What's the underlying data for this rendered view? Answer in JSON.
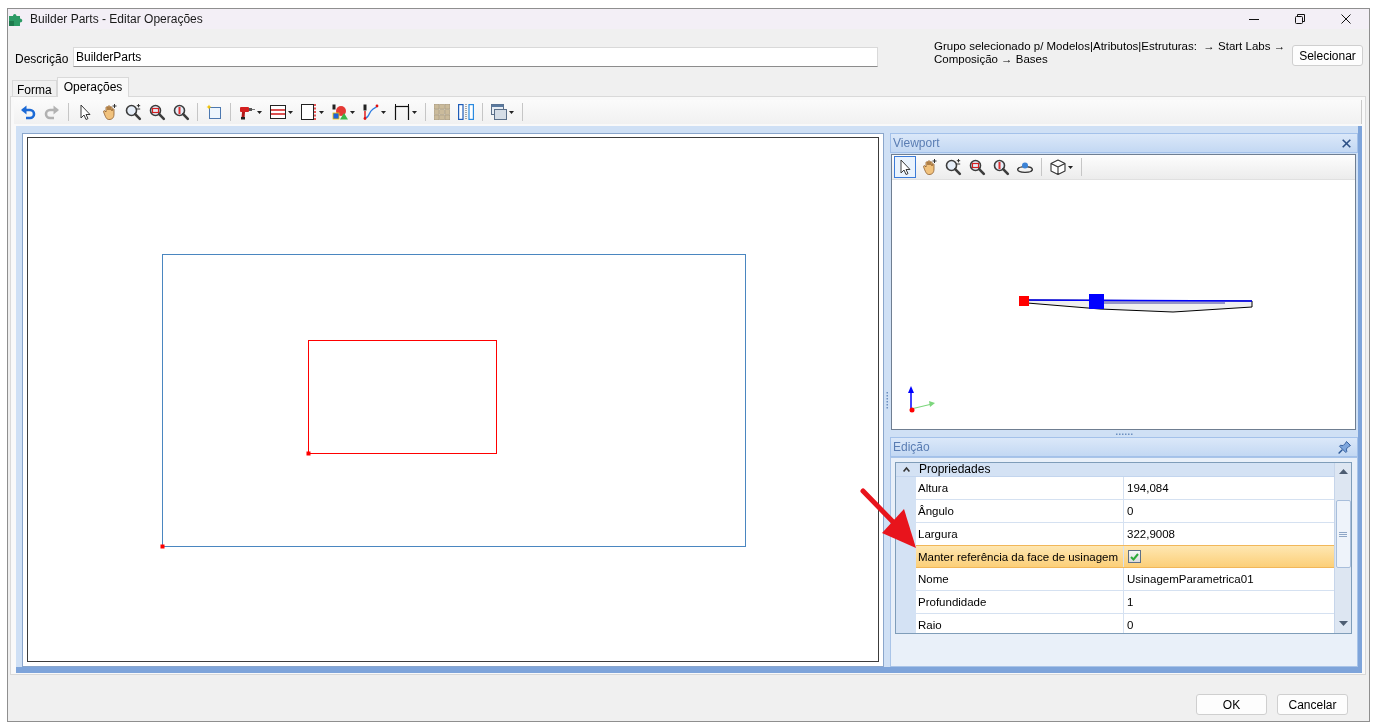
{
  "window": {
    "title": "Builder Parts - Editar Operações"
  },
  "description": {
    "label": "Descrição",
    "value": "BuilderParts"
  },
  "group_path": "Grupo selecionado p/ Modelos|Atributos|Estruturas:  → Start Labs → Composição → Bases",
  "select_button": "Selecionar",
  "tabs": [
    {
      "label": "Forma",
      "selected": false
    },
    {
      "label": "Operações",
      "selected": true
    }
  ],
  "toolbar": [
    {
      "disabled": false
    },
    {
      "disabled": true
    },
    {
      "disabled": false
    },
    {
      "disabled": false
    },
    {
      "disabled": false
    },
    {
      "disabled": false
    },
    {
      "disabled": false
    },
    {
      "disabled": false
    },
    {
      "disabled": false
    },
    {
      "disabled": false
    },
    {
      "disabled": false
    },
    {
      "disabled": false
    },
    {
      "disabled": false
    },
    {
      "disabled": false
    },
    {
      "disabled": false
    },
    {
      "disabled": false
    },
    {
      "disabled": false
    }
  ],
  "viewport": {
    "title": "Viewport",
    "toolbar": [
      {
        "selected": true
      },
      {
        "selected": false
      },
      {
        "selected": false
      },
      {
        "selected": false
      },
      {
        "selected": false
      },
      {
        "selected": false
      },
      {
        "selected": false
      }
    ]
  },
  "edit_panel": {
    "title": "Edição",
    "category": {
      "label": "Propriedades",
      "expanded": true
    },
    "properties": [
      {
        "kind": "text",
        "name": "Altura",
        "value": "194,084",
        "selected": false
      },
      {
        "kind": "text",
        "name": "Ângulo",
        "value": "0",
        "selected": false
      },
      {
        "kind": "text",
        "name": "Largura",
        "value": "322,9008",
        "selected": false
      },
      {
        "kind": "checkbox",
        "name": "Manter referência da face de usinagem",
        "checked": true,
        "selected": true
      },
      {
        "kind": "text",
        "name": "Nome",
        "value": "UsinagemParametrica01",
        "selected": false
      },
      {
        "kind": "text",
        "name": "Profundidade",
        "value": "1",
        "selected": false
      },
      {
        "kind": "text",
        "name": "Raio",
        "value": "0",
        "selected": false
      }
    ]
  },
  "buttons": [
    "OK",
    "Cancelar"
  ]
}
